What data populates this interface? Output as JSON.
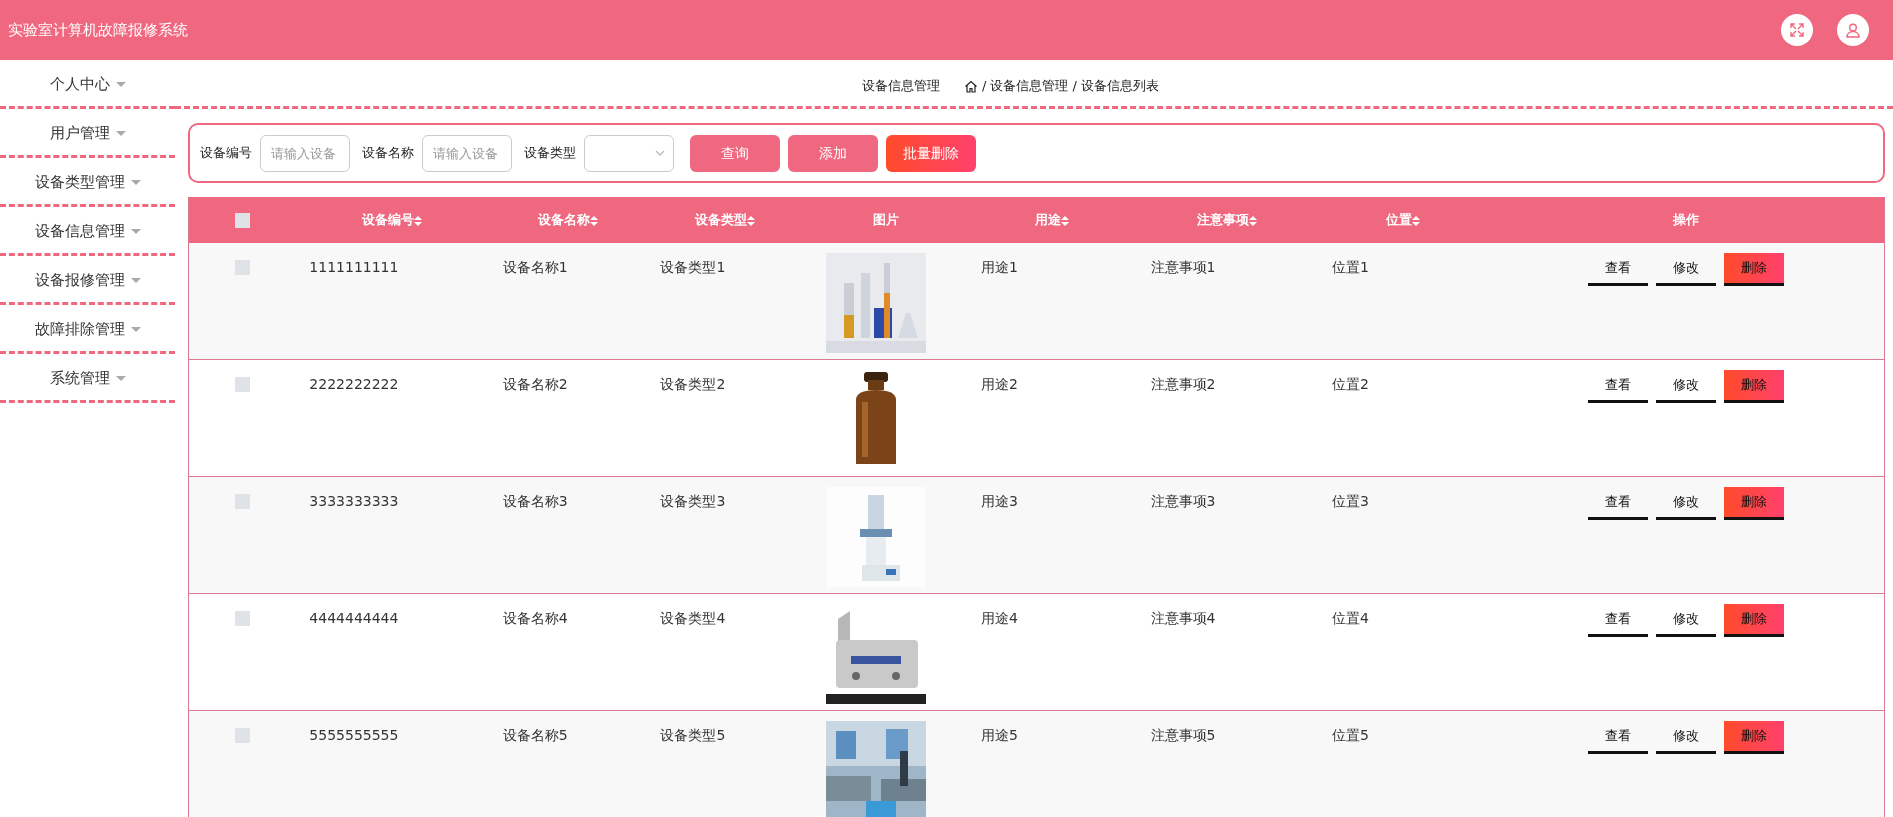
{
  "header": {
    "title": "实验室计算机故障报修系统"
  },
  "sidebar": {
    "items": [
      {
        "label": "个人中心"
      },
      {
        "label": "用户管理"
      },
      {
        "label": "设备类型管理"
      },
      {
        "label": "设备信息管理"
      },
      {
        "label": "设备报修管理"
      },
      {
        "label": "故障排除管理"
      },
      {
        "label": "系统管理"
      }
    ]
  },
  "breadcrumb": {
    "title": "设备信息管理",
    "separator": "/",
    "path": [
      "设备信息管理",
      "设备信息列表"
    ]
  },
  "search": {
    "fields": [
      {
        "kind": "input",
        "label": "设备编号",
        "placeholder": "请输入设备"
      },
      {
        "kind": "input",
        "label": "设备名称",
        "placeholder": "请输入设备"
      },
      {
        "kind": "select",
        "label": "设备类型"
      }
    ],
    "buttons": [
      {
        "label": "查询",
        "kind": "primary"
      },
      {
        "label": "添加",
        "kind": "primary"
      },
      {
        "label": "批量删除",
        "kind": "danger"
      }
    ]
  },
  "table": {
    "select_all": {
      "checked": false
    },
    "columns": [
      {
        "label": "设备编号",
        "sortable": true
      },
      {
        "label": "设备名称",
        "sortable": true
      },
      {
        "label": "设备类型",
        "sortable": true
      },
      {
        "label": "图片",
        "sortable": false
      },
      {
        "label": "用途",
        "sortable": true
      },
      {
        "label": "注意事项",
        "sortable": true
      },
      {
        "label": "位置",
        "sortable": true
      },
      {
        "label": "操作",
        "sortable": false
      }
    ],
    "rows": [
      {
        "checked": false,
        "cells": [
          "1111111111",
          "设备名称1",
          "设备类型1",
          {
            "kind": "picture"
          },
          "用途1",
          "注意事项1",
          "位置1"
        ],
        "actions": [
          {
            "label": "查看",
            "kind": "view"
          },
          {
            "label": "修改",
            "kind": "edit"
          },
          {
            "label": "删除",
            "kind": "delete"
          }
        ]
      },
      {
        "checked": false,
        "cells": [
          "2222222222",
          "设备名称2",
          "设备类型2",
          {
            "kind": "picture"
          },
          "用途2",
          "注意事项2",
          "位置2"
        ],
        "actions": [
          {
            "label": "查看",
            "kind": "view"
          },
          {
            "label": "修改",
            "kind": "edit"
          },
          {
            "label": "删除",
            "kind": "delete"
          }
        ]
      },
      {
        "checked": false,
        "cells": [
          "3333333333",
          "设备名称3",
          "设备类型3",
          {
            "kind": "picture"
          },
          "用途3",
          "注意事项3",
          "位置3"
        ],
        "actions": [
          {
            "label": "查看",
            "kind": "view"
          },
          {
            "label": "修改",
            "kind": "edit"
          },
          {
            "label": "删除",
            "kind": "delete"
          }
        ]
      },
      {
        "checked": false,
        "cells": [
          "4444444444",
          "设备名称4",
          "设备类型4",
          {
            "kind": "picture"
          },
          "用途4",
          "注意事项4",
          "位置4"
        ],
        "actions": [
          {
            "label": "查看",
            "kind": "view"
          },
          {
            "label": "修改",
            "kind": "edit"
          },
          {
            "label": "删除",
            "kind": "delete"
          }
        ]
      },
      {
        "checked": false,
        "cells": [
          "5555555555",
          "设备名称5",
          "设备类型5",
          {
            "kind": "picture"
          },
          "用途5",
          "注意事项5",
          "位置5"
        ],
        "actions": [
          {
            "label": "查看",
            "kind": "view"
          },
          {
            "label": "修改",
            "kind": "edit"
          },
          {
            "label": "删除",
            "kind": "delete"
          }
        ]
      }
    ]
  }
}
